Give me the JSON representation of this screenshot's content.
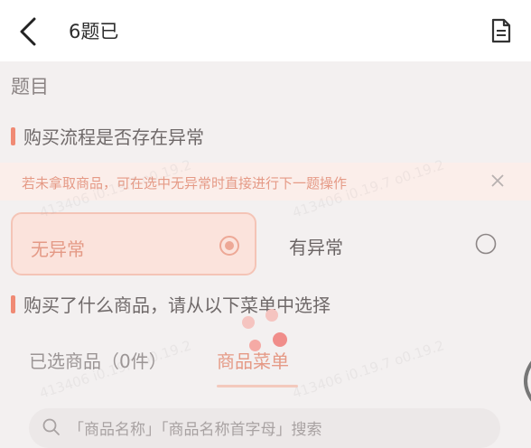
{
  "header": {
    "title": "6题已",
    "back_icon": "chevron-left-icon",
    "doc_icon": "document-icon"
  },
  "section": {
    "heading": "题目"
  },
  "question1": {
    "text": "购买流程是否存在异常"
  },
  "tip": {
    "text": "若未拿取商品，可在选中无异常时直接进行下一题操作",
    "close_icon": "close-icon"
  },
  "options": [
    {
      "label": "无异常",
      "selected": true
    },
    {
      "label": "有异常",
      "selected": false
    }
  ],
  "question2": {
    "text": "购买了什么商品，请从以下菜单中选择"
  },
  "tabs": {
    "selected_goods": "已选商品（0件）",
    "goods_menu": "商品菜单"
  },
  "search": {
    "placeholder": "「商品名称」「商品名称首字母」搜索",
    "icon": "search-icon"
  },
  "watermark": "413406 i0.19.7 o0.19.2",
  "colors": {
    "accent": "#f08a74",
    "accent_light": "#fbe3dc",
    "tip_text": "#e59a86"
  }
}
